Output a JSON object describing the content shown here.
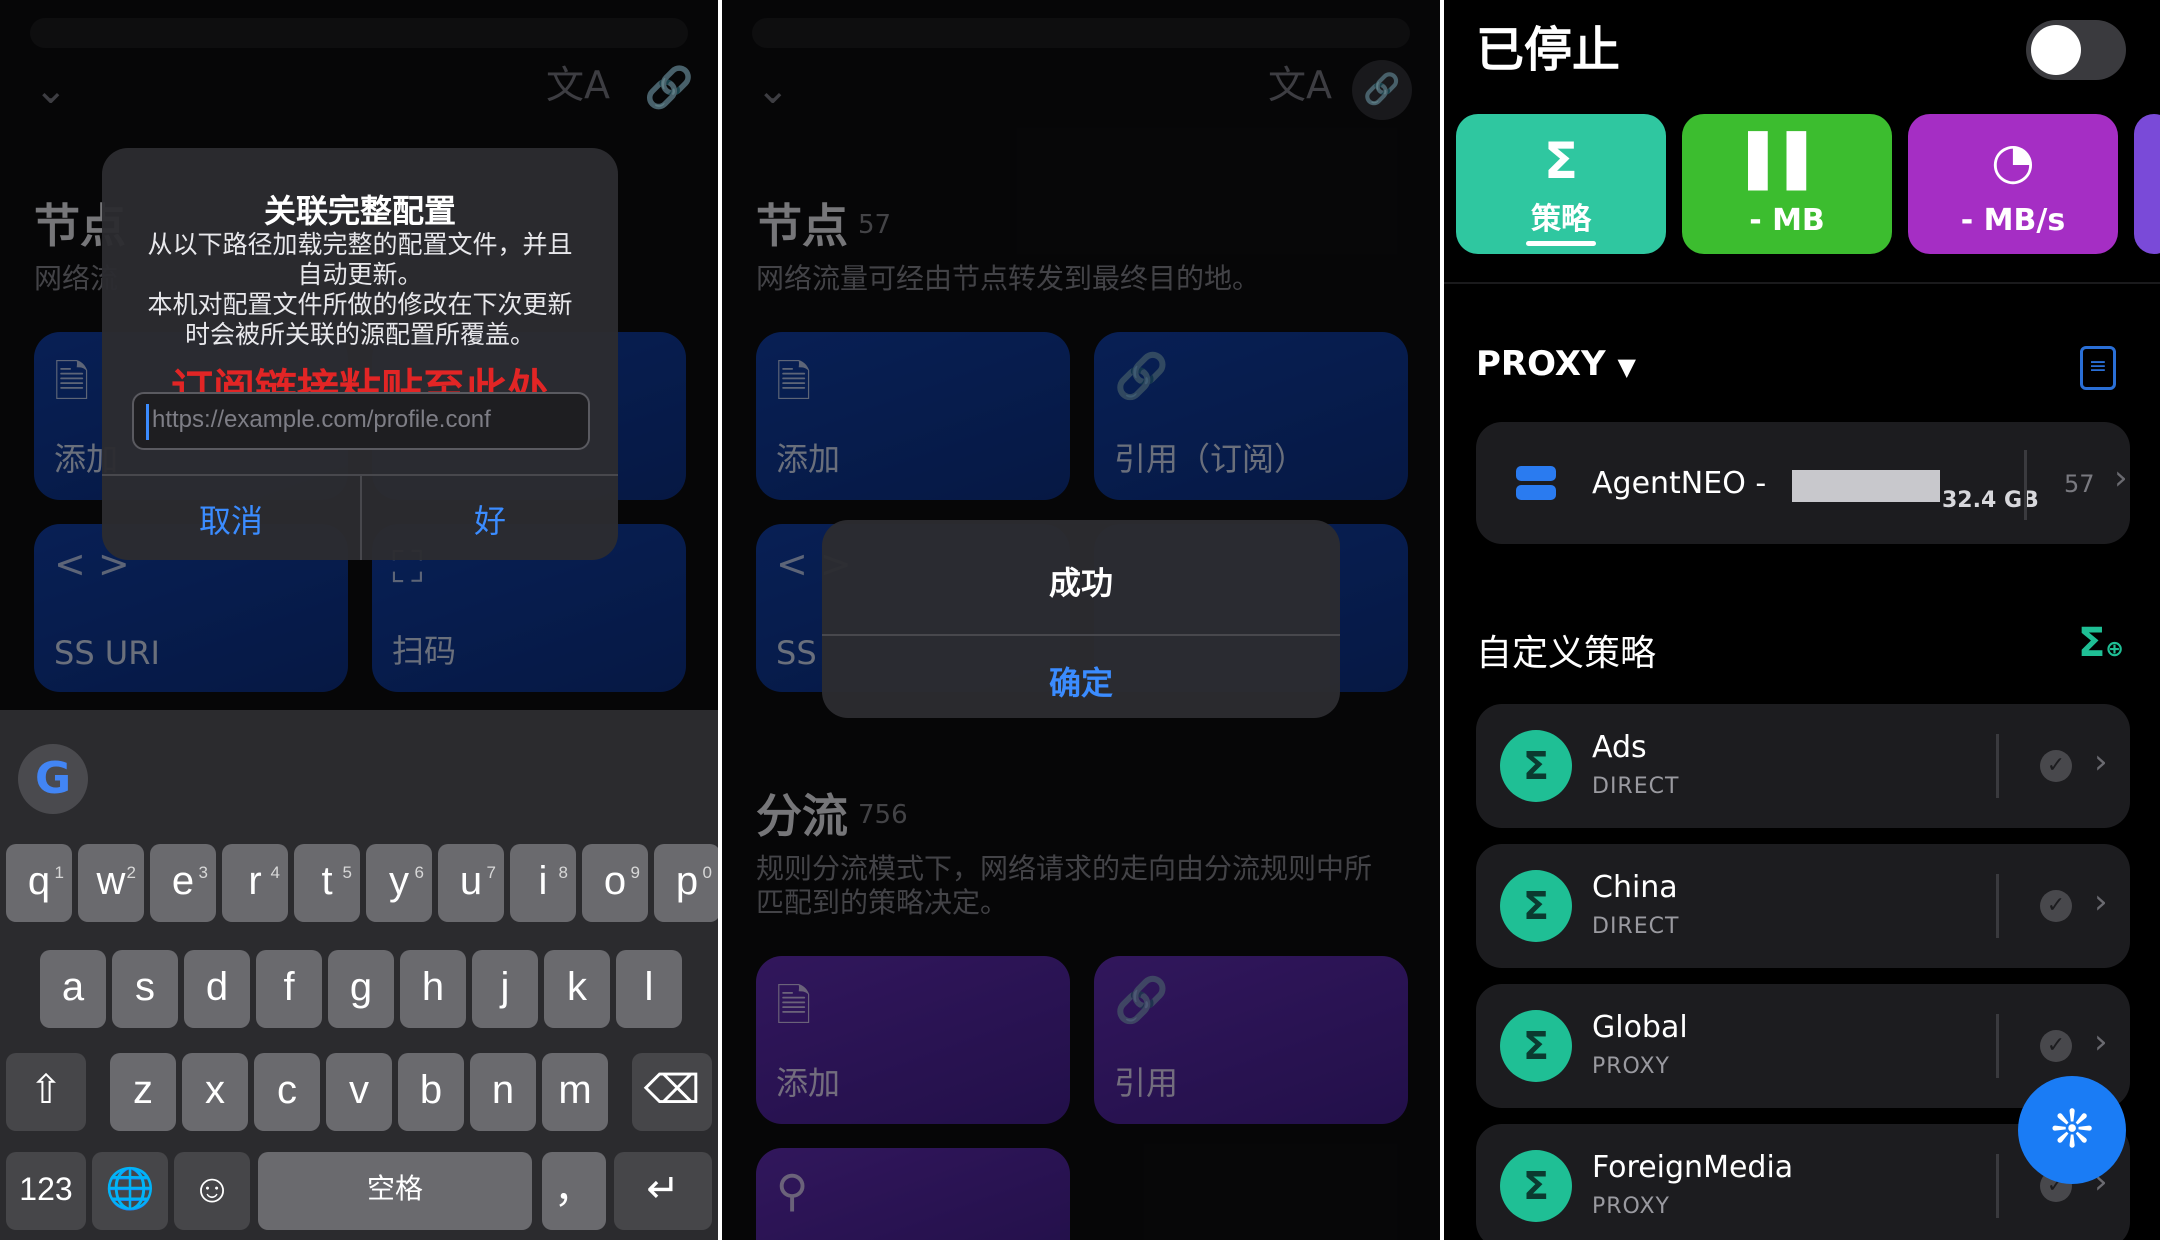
{
  "panel1": {
    "section_title": "节点",
    "section_desc_fragment": "网络流",
    "card_add": "添加",
    "card_ss_uri": "SS URI",
    "card_scan": "扫码",
    "dialog": {
      "title": "关联完整配置",
      "message_line1": "从以下路径加载完整的配置文件，并且",
      "message_line2": "自动更新。",
      "message_line3": "本机对配置文件所做的修改在下次更新",
      "message_line4": "时会被所关联的源配置所覆盖。",
      "annotation": "订阅链接粘贴至此处",
      "input_placeholder": "https://example.com/profile.conf",
      "cancel": "取消",
      "ok": "好"
    },
    "keyboard": {
      "row1": [
        {
          "k": "q",
          "n": "1"
        },
        {
          "k": "w",
          "n": "2"
        },
        {
          "k": "e",
          "n": "3"
        },
        {
          "k": "r",
          "n": "4"
        },
        {
          "k": "t",
          "n": "5"
        },
        {
          "k": "y",
          "n": "6"
        },
        {
          "k": "u",
          "n": "7"
        },
        {
          "k": "i",
          "n": "8"
        },
        {
          "k": "o",
          "n": "9"
        },
        {
          "k": "p",
          "n": "0"
        }
      ],
      "row2": [
        "a",
        "s",
        "d",
        "f",
        "g",
        "h",
        "j",
        "k",
        "l"
      ],
      "row3": [
        "z",
        "x",
        "c",
        "v",
        "b",
        "n",
        "m"
      ],
      "numbers_key": "123",
      "space_key": "空格",
      "comma_key": "，"
    }
  },
  "panel2": {
    "nodes_title": "节点",
    "nodes_count": "57",
    "nodes_desc": "网络流量可经由节点转发到最终目的地。",
    "card_add": "添加",
    "card_ref_sub": "引用（订阅）",
    "card_ss_fragment": "SS",
    "rules_title": "分流",
    "rules_count": "756",
    "rules_desc_line1": "规则分流模式下，网络请求的走向由分流规则中所",
    "rules_desc_line2": "匹配到的策略决定。",
    "card_add2": "添加",
    "card_ref": "引用",
    "success_dialog": {
      "title": "成功",
      "confirm": "确定"
    }
  },
  "panel3": {
    "status": "已停止",
    "tiles": [
      {
        "label": "策略",
        "icon": "policy-icon",
        "color": "#2fc7a0"
      },
      {
        "label": "- MB",
        "icon": "bar-chart-icon",
        "color": "#3cbd2f"
      },
      {
        "label": "- MB/s",
        "icon": "gauge-icon",
        "color": "#a52ec4"
      }
    ],
    "proxy_group": "PROXY",
    "node": {
      "name": "AgentNEO -",
      "traffic": "32.4 GB",
      "count": "57"
    },
    "custom_title": "自定义策略",
    "policies": [
      {
        "name": "Ads",
        "sub": "DIRECT"
      },
      {
        "name": "China",
        "sub": "DIRECT"
      },
      {
        "name": "Global",
        "sub": "PROXY"
      },
      {
        "name": "ForeignMedia",
        "sub": "PROXY"
      }
    ]
  }
}
